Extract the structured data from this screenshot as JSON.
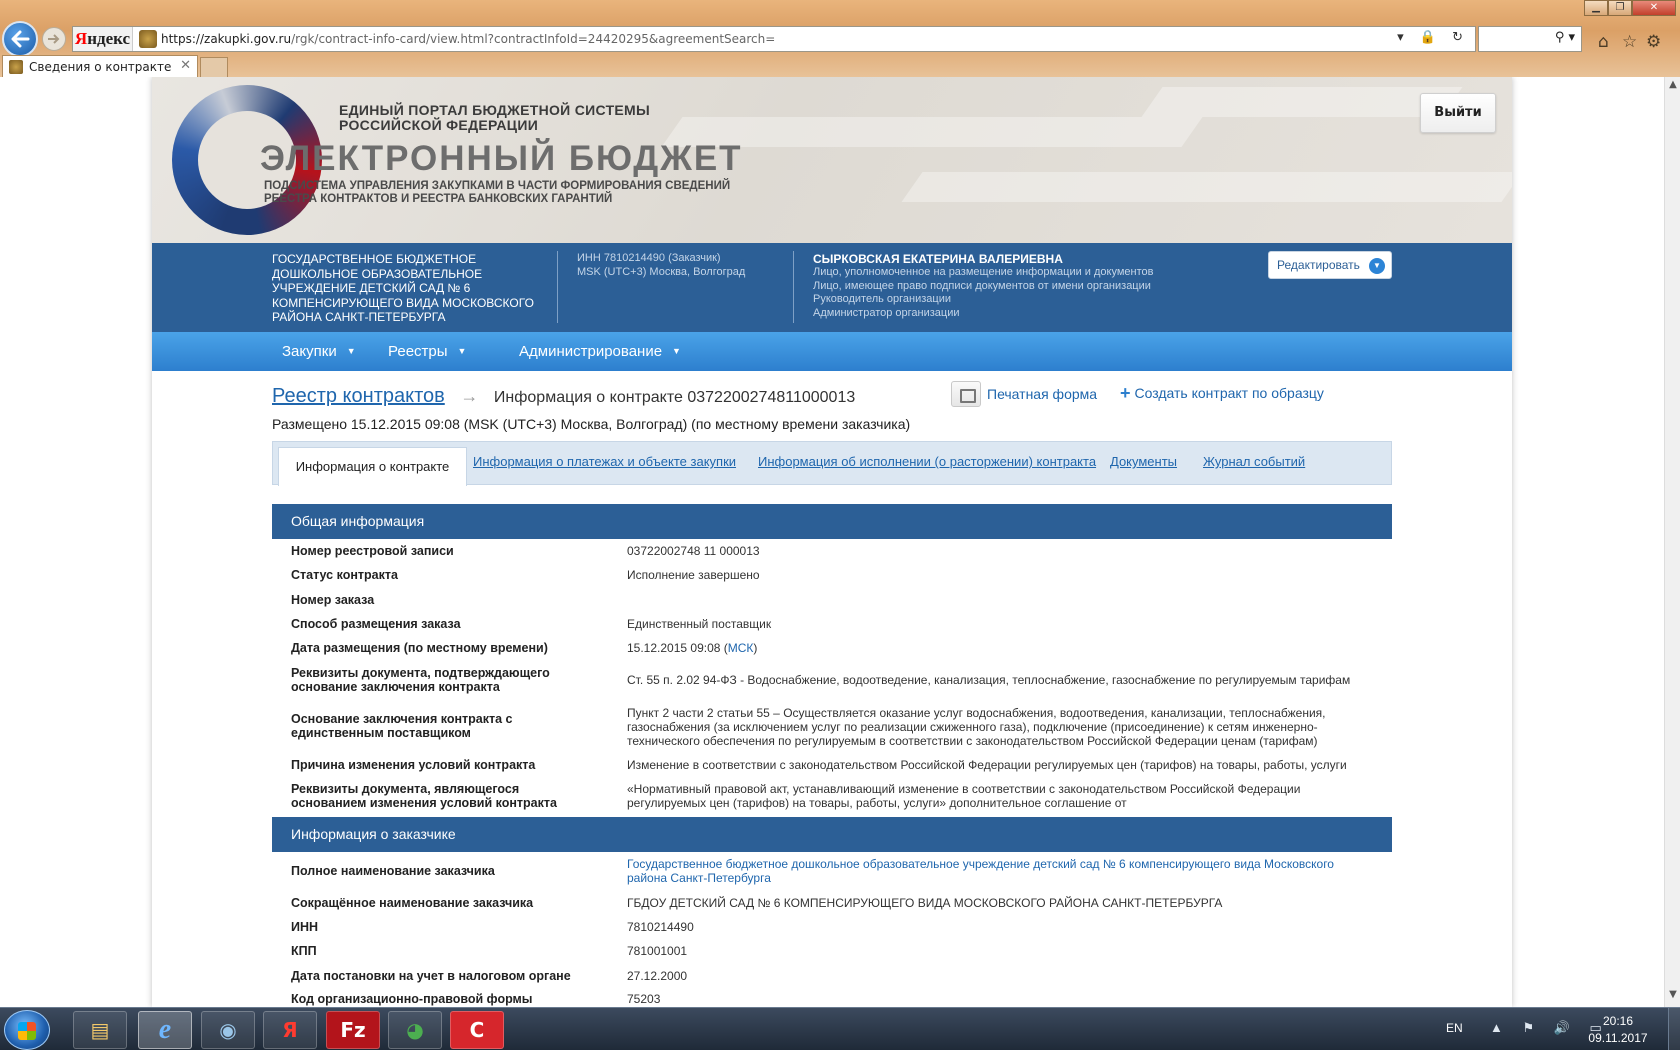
{
  "browser": {
    "url_host": "https://zakupki.gov.ru",
    "url_path": "/rgk/contract-info-card/view.html?contractInfoId=24420295&agreementSearch=",
    "tab_title": "Сведения о контракте",
    "address_controls": "▾ 🔒 ↻",
    "search_icon": "⚲ ▾",
    "home_icon": "home-icon",
    "yandex_y": "Я",
    "yandex_rest": "ндекс"
  },
  "portal": {
    "line1a": "ЕДИНЫЙ ПОРТАЛ БЮДЖЕТНОЙ СИСТЕМЫ",
    "line1b": "РОССИЙСКОЙ ФЕДЕРАЦИИ",
    "main_title": "ЭЛЕКТРОННЫЙ БЮДЖЕТ",
    "sub_a": "ПОДСИСТЕМА УПРАВЛЕНИЯ ЗАКУПКАМИ В ЧАСТИ ФОРМИРОВАНИЯ СВЕДЕНИЙ",
    "sub_b": "РЕЕСТРА КОНТРАКТОВ И РЕЕСТРА БАНКОВСКИХ ГАРАНТИЙ",
    "logout": "Выйти"
  },
  "org": {
    "name": "Государственное бюджетное дошкольное образовательное учреждение детский сад № 6 компенсирующего вида Московского района Санкт-Петербурга",
    "inn": "ИНН 7810214490 (Заказчик)",
    "tz": "MSK (UTC+3) Москва, Волгоград",
    "user_name": "СЫРКОВСКАЯ ЕКАТЕРИНА ВАЛЕРИЕВНА",
    "roles": [
      "Лицо, уполномоченное на размещение информации и документов",
      "Лицо, имеющее право подписи документов от имени организации",
      "Руководитель организации",
      "Администратор организации"
    ],
    "edit": "Редактировать"
  },
  "menu": [
    "Закупки",
    "Реестры",
    "Администрирование"
  ],
  "content": {
    "breadcrumb_link": "Реестр контрактов",
    "breadcrumb_current": "Информация о контракте 0372200274811000013",
    "print": "Печатная форма",
    "create": "Создать контракт по образцу",
    "posted": "Размещено 15.12.2015 09:08 (MSK (UTC+3) Москва, Волгоград) (по местному времени заказчика)",
    "tabs": [
      "Информация о контракте",
      "Информация о платежах и объекте закупки",
      "Информация об исполнении (о расторжении) контракта",
      "Документы",
      "Журнал событий"
    ]
  },
  "general": {
    "title": "Общая информация",
    "rows": [
      {
        "label": "Номер реестровой записи",
        "value": "03722002748 11 000013"
      },
      {
        "label": "Статус контракта",
        "value": "Исполнение завершено"
      },
      {
        "label": "Номер заказа",
        "value": ""
      },
      {
        "label": "Способ размещения заказа",
        "value": "Единственный поставщик"
      },
      {
        "label": "Дата размещения (по местному времени)",
        "value": "15.12.2015 09:08 (",
        "value_link": "МСК",
        "value_tail": ")"
      },
      {
        "label": "Реквизиты документа, подтверждающего основание заключения контракта",
        "value": "Ст. 55 п. 2.02 94-ФЗ - Водоснабжение, водоотведение, канализация, теплоснабжение, газоснабжение по регулируемым тарифам"
      },
      {
        "label": "Основание заключения контракта с единственным поставщиком",
        "value": "Пункт 2 части 2 статьи 55 – Осуществляется оказание услуг водоснабжения, водоотведения, канализации, теплоснабжения, газоснабжения (за исключением услуг по реализации сжиженного газа), подключение (присоединение) к сетям инженерно-технического обеспечения по регулируемым в соответствии с законодательством Российской Федерации ценам (тарифам)"
      },
      {
        "label": "Причина изменения условий контракта",
        "value": "Изменение в соответствии с законодательством Российской Федерации регулируемых цен (тарифов) на товары, работы, услуги"
      },
      {
        "label": "Реквизиты документа, являющегося основанием изменения условий контракта",
        "value": "«Нормативный правовой акт, устанавливающий изменение в соответствии с законодательством Российской Федерации регулируемых цен (тарифов) на товары, работы, услуги» дополнительное соглашение от"
      }
    ]
  },
  "customer": {
    "title": "Информация о заказчике",
    "rows": [
      {
        "label": "Полное наименование заказчика",
        "value": "Государственное бюджетное дошкольное образовательное учреждение детский сад № 6 компенсирующего вида Московского района Санкт-Петербурга"
      },
      {
        "label": "Сокращённое наименование заказчика",
        "value": "ГБДОУ ДЕТСКИЙ САД № 6 КОМПЕНСИРУЮЩЕГО ВИДА МОСКОВСКОГО РАЙОНА САНКТ-ПЕТЕРБУРГА"
      },
      {
        "label": "ИНН",
        "value": "7810214490"
      },
      {
        "label": "КПП",
        "value": "781001001"
      },
      {
        "label": "Дата постановки на учет в налоговом органе",
        "value": "27.12.2000"
      },
      {
        "label": "Код организационно-правовой формы",
        "value": "75203"
      }
    ]
  },
  "taskbar": {
    "lang": "EN",
    "time": "20:16",
    "date": "09.11.2017",
    "apps": [
      "file-explorer-icon",
      "internet-explorer-icon",
      "eye-app-icon",
      "yandex-browser-icon",
      "filezilla-icon",
      "chrome-icon",
      "app-icon"
    ],
    "app_glyphs": [
      "▤",
      "e",
      "◉",
      "Я",
      "Fz",
      "◕",
      "C"
    ]
  }
}
